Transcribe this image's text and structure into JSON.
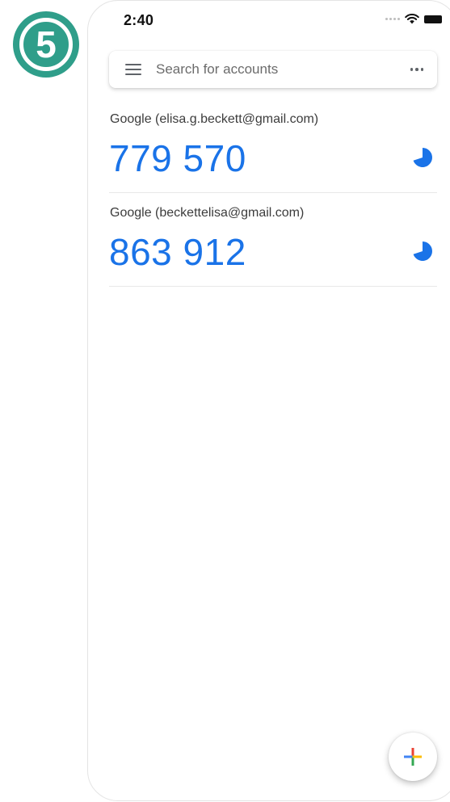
{
  "step_badge": {
    "label": "5"
  },
  "status_bar": {
    "time": "2:40"
  },
  "search": {
    "placeholder": "Search for accounts"
  },
  "accounts": [
    {
      "name": "Google (elisa.g.beckett@gmail.com)",
      "code": "779 570",
      "time_remaining_fraction": 0.7
    },
    {
      "name": "Google (beckettelisa@gmail.com)",
      "code": "863 912",
      "time_remaining_fraction": 0.7
    }
  ],
  "icons": {
    "menu": "hamburger-menu-icon",
    "more": "more-horizontal-icon",
    "timer": "countdown-pie-icon",
    "add": "plus-icon",
    "wifi": "wifi-icon",
    "battery": "battery-icon"
  },
  "colors": {
    "code_blue": "#1a73e8",
    "badge_teal": "#2f9e8a",
    "fab_plus": [
      "#4285f4",
      "#ea4335",
      "#fbbc05",
      "#34a853"
    ]
  }
}
